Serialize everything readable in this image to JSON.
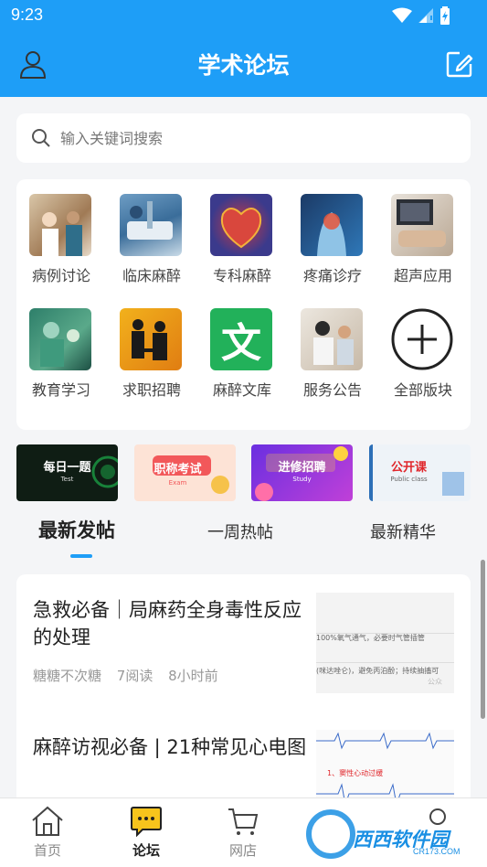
{
  "status": {
    "time": "9:23"
  },
  "header": {
    "title": "学术论坛"
  },
  "search": {
    "placeholder": "输入关键词搜索"
  },
  "categories": [
    {
      "label": "病例讨论",
      "icon": "case-discussion-photo"
    },
    {
      "label": "临床麻醉",
      "icon": "clinical-anesthesia-photo"
    },
    {
      "label": "专科麻醉",
      "icon": "specialty-anesthesia-heart"
    },
    {
      "label": "疼痛诊疗",
      "icon": "pain-treatment-photo"
    },
    {
      "label": "超声应用",
      "icon": "ultrasound-photo"
    },
    {
      "label": "教育学习",
      "icon": "education-photo"
    },
    {
      "label": "求职招聘",
      "icon": "job-recruitment-photo"
    },
    {
      "label": "麻醉文库",
      "icon": "library-wen"
    },
    {
      "label": "服务公告",
      "icon": "service-notice-photo"
    },
    {
      "label": "全部版块",
      "icon": "plus-circle-icon"
    }
  ],
  "library_glyph": "文",
  "banners": [
    {
      "text": "每日一题",
      "sub": "Test",
      "bg": "#0d1a12",
      "fg": "#ffffff"
    },
    {
      "text": "职称考试",
      "sub": "Exam",
      "bg": "#fde3d6",
      "fg": "#ffffff"
    },
    {
      "text": "进修招聘",
      "sub": "Study",
      "bg": "#8a3ee8",
      "fg": "#ffffff"
    },
    {
      "text": "公开课",
      "sub": "Public class",
      "bg": "#eef3f8",
      "fg": "#e0262b"
    }
  ],
  "tabs": [
    {
      "label": "最新发帖",
      "active": true
    },
    {
      "label": "一周热帖",
      "active": false
    },
    {
      "label": "最新精华",
      "active": false
    }
  ],
  "posts": [
    {
      "title": "急救必备｜局麻药全身毒性反应的处理",
      "author": "糖糖不次糖",
      "reads": "7阅读",
      "time": "8小时前",
      "thumb_lines": [
        "100%氧气通气，必要时气管插管",
        "(咪达唑仑)，避免丙泊酚；持续抽搐可",
        "公众"
      ]
    },
    {
      "title": "麻醉访视必备 | 21种常见心电图",
      "thumb_lines": [
        "1、窦性心动过缓"
      ]
    }
  ],
  "bottom_nav": [
    {
      "label": "首页",
      "icon": "home-icon",
      "active": false
    },
    {
      "label": "论坛",
      "icon": "forum-chat-icon",
      "active": true
    },
    {
      "label": "网店",
      "icon": "cart-icon",
      "active": false
    },
    {
      "label": "",
      "icon": "profile-icon",
      "active": false
    }
  ],
  "watermark": {
    "text": "西西软件园",
    "sub": "CR173.COM"
  },
  "colors": {
    "primary": "#1e9ef7",
    "background": "#f4f5f7"
  }
}
